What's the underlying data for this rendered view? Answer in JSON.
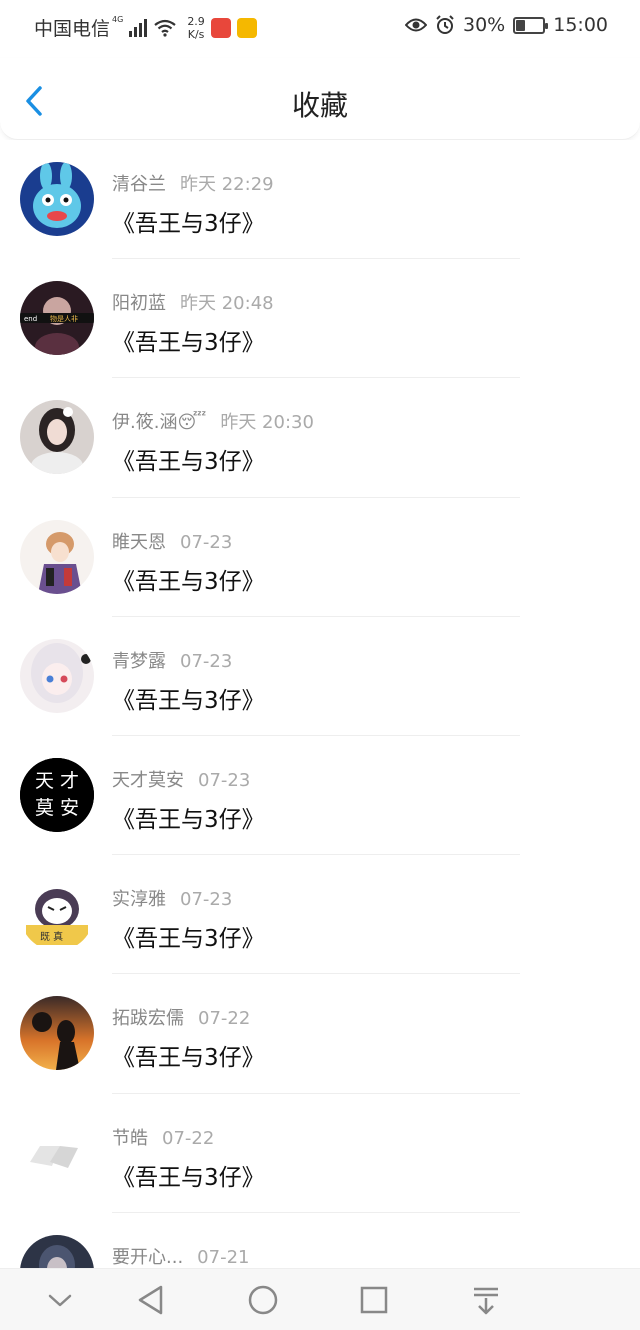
{
  "status_bar": {
    "carrier": "中国电信",
    "network": "4G",
    "speed_value": "2.9",
    "speed_unit": "K/s",
    "battery": "30%",
    "battery_level": 0.3,
    "time": "15:00"
  },
  "header": {
    "title": "收藏"
  },
  "items": [
    {
      "name": "清谷兰",
      "time": "昨天 22:29",
      "content": "《吾王与3仔》"
    },
    {
      "name": "阳初蓝",
      "time": "昨天 20:48",
      "content": "《吾王与3仔》"
    },
    {
      "name": "伊.筱.涵😴",
      "time": "昨天 20:30",
      "content": "《吾王与3仔》"
    },
    {
      "name": "睢天恩",
      "time": "07-23",
      "content": "《吾王与3仔》"
    },
    {
      "name": "青梦露",
      "time": "07-23",
      "content": "《吾王与3仔》"
    },
    {
      "name": "天才莫安",
      "time": "07-23",
      "content": "《吾王与3仔》"
    },
    {
      "name": "实淳雅",
      "time": "07-23",
      "content": "《吾王与3仔》"
    },
    {
      "name": "拓跋宏儒",
      "time": "07-22",
      "content": "《吾王与3仔》"
    },
    {
      "name": "节皓",
      "time": "07-22",
      "content": "《吾王与3仔》"
    },
    {
      "name": "要开心...",
      "time": "07-21",
      "content": ""
    }
  ],
  "avatar_art": {
    "tiancai_lines": [
      "天 才",
      "莫 安"
    ],
    "end_caption": "end",
    "wushi_caption": "物是人非",
    "book_caption": "既 真"
  },
  "colors": {
    "accent": "#1a8fe3"
  }
}
